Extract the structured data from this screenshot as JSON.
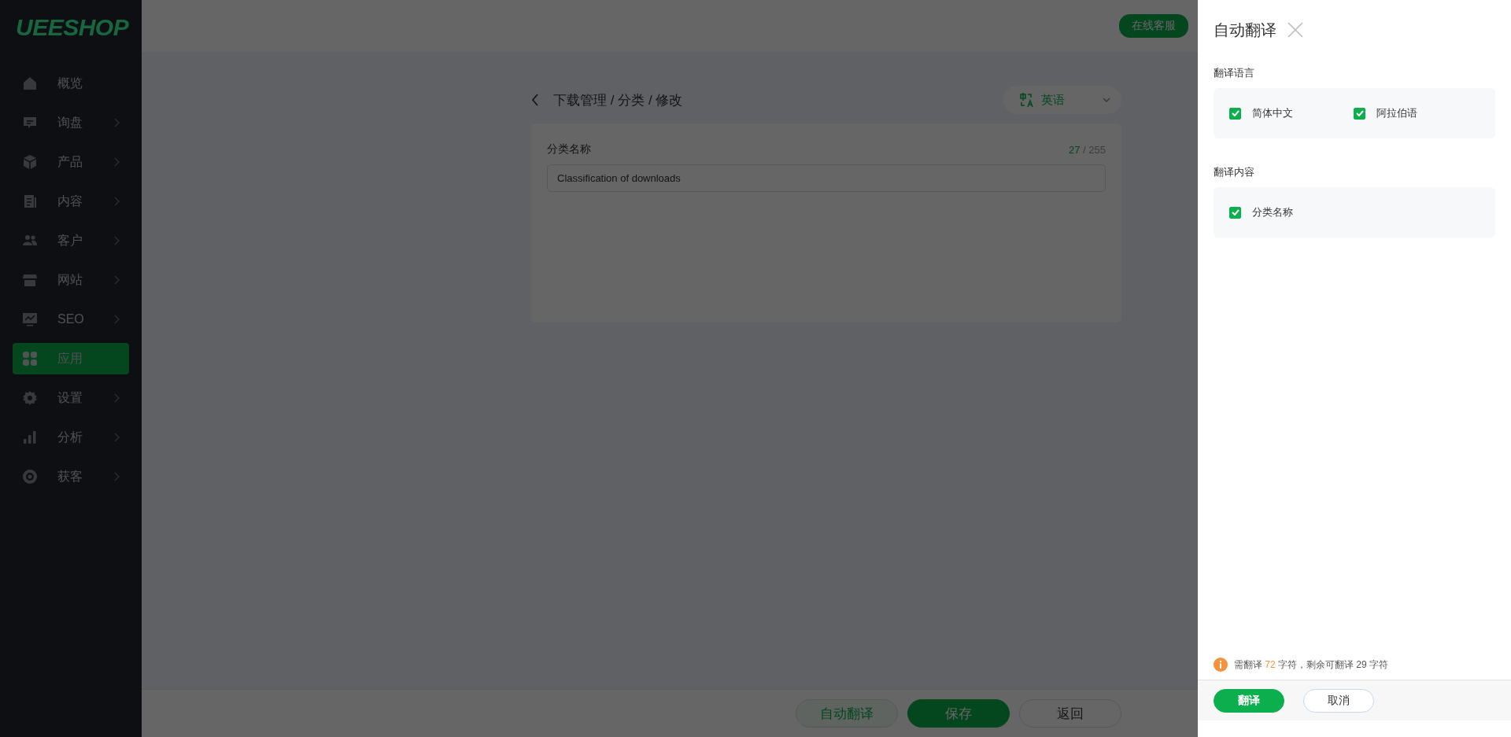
{
  "logo": "UEESHOP",
  "sidebar": {
    "items": [
      {
        "label": "概览",
        "expandable": false,
        "selected": false
      },
      {
        "label": "询盘",
        "expandable": true,
        "selected": false
      },
      {
        "label": "产品",
        "expandable": true,
        "selected": false
      },
      {
        "label": "内容",
        "expandable": true,
        "selected": false
      },
      {
        "label": "客户",
        "expandable": true,
        "selected": false
      },
      {
        "label": "网站",
        "expandable": true,
        "selected": false
      },
      {
        "label": "SEO",
        "expandable": true,
        "selected": false
      },
      {
        "label": "应用",
        "expandable": false,
        "selected": true
      },
      {
        "label": "设置",
        "expandable": true,
        "selected": false
      },
      {
        "label": "分析",
        "expandable": true,
        "selected": false
      },
      {
        "label": "获客",
        "expandable": true,
        "selected": false
      }
    ]
  },
  "header": {
    "support_button": "在线客服"
  },
  "page": {
    "breadcrumb": "下载管理 / 分类 / 修改",
    "language_select": {
      "value": "英语"
    },
    "form": {
      "label": "分类名称",
      "count_used": "27",
      "count_rest": " / 255",
      "value": "Classification of downloads"
    }
  },
  "footer_buttons": [
    {
      "label": "自动翻译",
      "kind": "outline"
    },
    {
      "label": "保存",
      "kind": "primary"
    },
    {
      "label": "返回",
      "kind": "default"
    }
  ],
  "drawer": {
    "title": "自动翻译",
    "sections": [
      {
        "label": "翻译语言",
        "options": [
          {
            "label": "简体中文",
            "checked": true
          },
          {
            "label": "阿拉伯语",
            "checked": true
          }
        ]
      },
      {
        "label": "翻译内容",
        "options": [
          {
            "label": "分类名称",
            "checked": true
          }
        ]
      }
    ],
    "notice": {
      "before": "需翻译 ",
      "highlight": "72",
      "after": " 字符，剩余可翻译 29 字符"
    },
    "buttons": [
      {
        "label": "翻译",
        "kind": "primary"
      },
      {
        "label": "取消",
        "kind": "default"
      }
    ]
  }
}
